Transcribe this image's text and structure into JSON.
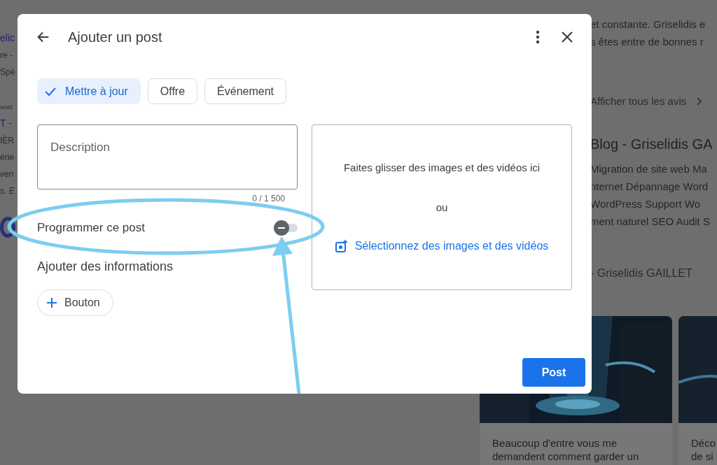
{
  "background": {
    "left_fragments": [
      {
        "text": "elic",
        "kind": "link"
      },
      {
        "text": "re -",
        "kind": "plain"
      },
      {
        "text": "Spé",
        "kind": "plain"
      },
      {
        "text": "unet",
        "kind": "small"
      },
      {
        "text": "T -",
        "kind": "link"
      },
      {
        "text": "IÈR",
        "kind": "plain"
      },
      {
        "text": "érie",
        "kind": "plain"
      },
      {
        "text": "ven",
        "kind": "italic"
      },
      {
        "text": "s. E",
        "kind": "italic"
      }
    ],
    "right_column": {
      "review_lines": [
        "et constante. Griselidis e",
        "s êtes entre de bonnes r"
      ],
      "all_reviews_link": "Afficher tous les avis",
      "blog_title": "Blog - Griselidis GA",
      "blog_lines": [
        "Migration de site web Ma",
        "nternet Dépannage Word",
        "WordPress Support Wo",
        "ment naturel SEO Audit S"
      ],
      "author": "- Griselidis GAILLET"
    },
    "cards": [
      {
        "lines": [
          "Beaucoup d'entre vous me",
          "demandent comment garder un"
        ]
      },
      {
        "lines": [
          "Déco",
          "de si"
        ]
      }
    ]
  },
  "dialog": {
    "title": "Ajouter un post",
    "chips": [
      {
        "label": "Mettre à jour",
        "selected": true
      },
      {
        "label": "Offre",
        "selected": false
      },
      {
        "label": "Événement",
        "selected": false
      }
    ],
    "description": {
      "placeholder": "Description"
    },
    "counter": "0 / 1 500",
    "schedule": {
      "label": "Programmer ce post",
      "on": false
    },
    "add_info_label": "Ajouter des informations",
    "add_button": "Bouton",
    "dropzone": {
      "hint": "Faites glisser des images et des vidéos ici",
      "or": "ou",
      "link": "Sélectionnez des images et des vidéos"
    },
    "post_button": "Post"
  }
}
